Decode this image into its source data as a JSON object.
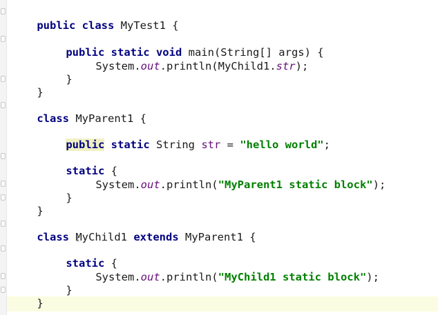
{
  "code": {
    "l1": {
      "a": "public class",
      "b": " MyTest1 {"
    },
    "l2": {
      "a": "public static void",
      "b": " main(String[] args) {"
    },
    "l3": {
      "a": "System.",
      "b": "out",
      "c": ".println(MyChild1.",
      "d": "str",
      "e": ");"
    },
    "l4": "}",
    "l5": "}",
    "l6": {
      "a": "class",
      "b": " MyParent1 {"
    },
    "l7": {
      "a": "public",
      "b": " ",
      "c": "static",
      "d": " String ",
      "e": "str",
      "f": " = ",
      "g": "\"hello world\"",
      "h": ";"
    },
    "l8": "static {",
    "l9": {
      "a": "System.",
      "b": "out",
      "c": ".println(",
      "d": "\"MyParent1 static block\"",
      "e": ");"
    },
    "l10": "}",
    "l11": "}",
    "l12": {
      "a": "class",
      "b": " MyChild1 ",
      "c": "extends",
      "d": " MyParent1 {"
    },
    "l13": "static {",
    "l14": {
      "a": "System.",
      "b": "out",
      "c": ".println(",
      "d": "\"MyChild1 static block\"",
      "e": ");"
    },
    "l15": "}",
    "l16": "}"
  },
  "caret_glyph": "I"
}
